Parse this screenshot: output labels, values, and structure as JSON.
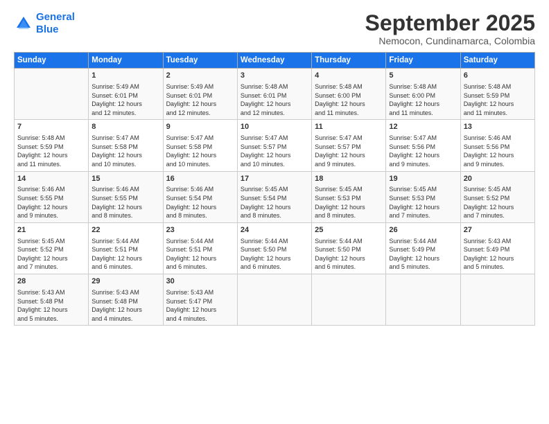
{
  "logo": {
    "line1": "General",
    "line2": "Blue"
  },
  "title": "September 2025",
  "subtitle": "Nemocon, Cundinamarca, Colombia",
  "days_of_week": [
    "Sunday",
    "Monday",
    "Tuesday",
    "Wednesday",
    "Thursday",
    "Friday",
    "Saturday"
  ],
  "weeks": [
    [
      {
        "day": "",
        "text": ""
      },
      {
        "day": "1",
        "text": "Sunrise: 5:49 AM\nSunset: 6:01 PM\nDaylight: 12 hours\nand 12 minutes."
      },
      {
        "day": "2",
        "text": "Sunrise: 5:49 AM\nSunset: 6:01 PM\nDaylight: 12 hours\nand 12 minutes."
      },
      {
        "day": "3",
        "text": "Sunrise: 5:48 AM\nSunset: 6:01 PM\nDaylight: 12 hours\nand 12 minutes."
      },
      {
        "day": "4",
        "text": "Sunrise: 5:48 AM\nSunset: 6:00 PM\nDaylight: 12 hours\nand 11 minutes."
      },
      {
        "day": "5",
        "text": "Sunrise: 5:48 AM\nSunset: 6:00 PM\nDaylight: 12 hours\nand 11 minutes."
      },
      {
        "day": "6",
        "text": "Sunrise: 5:48 AM\nSunset: 5:59 PM\nDaylight: 12 hours\nand 11 minutes."
      }
    ],
    [
      {
        "day": "7",
        "text": "Sunrise: 5:48 AM\nSunset: 5:59 PM\nDaylight: 12 hours\nand 11 minutes."
      },
      {
        "day": "8",
        "text": "Sunrise: 5:47 AM\nSunset: 5:58 PM\nDaylight: 12 hours\nand 10 minutes."
      },
      {
        "day": "9",
        "text": "Sunrise: 5:47 AM\nSunset: 5:58 PM\nDaylight: 12 hours\nand 10 minutes."
      },
      {
        "day": "10",
        "text": "Sunrise: 5:47 AM\nSunset: 5:57 PM\nDaylight: 12 hours\nand 10 minutes."
      },
      {
        "day": "11",
        "text": "Sunrise: 5:47 AM\nSunset: 5:57 PM\nDaylight: 12 hours\nand 9 minutes."
      },
      {
        "day": "12",
        "text": "Sunrise: 5:47 AM\nSunset: 5:56 PM\nDaylight: 12 hours\nand 9 minutes."
      },
      {
        "day": "13",
        "text": "Sunrise: 5:46 AM\nSunset: 5:56 PM\nDaylight: 12 hours\nand 9 minutes."
      }
    ],
    [
      {
        "day": "14",
        "text": "Sunrise: 5:46 AM\nSunset: 5:55 PM\nDaylight: 12 hours\nand 9 minutes."
      },
      {
        "day": "15",
        "text": "Sunrise: 5:46 AM\nSunset: 5:55 PM\nDaylight: 12 hours\nand 8 minutes."
      },
      {
        "day": "16",
        "text": "Sunrise: 5:46 AM\nSunset: 5:54 PM\nDaylight: 12 hours\nand 8 minutes."
      },
      {
        "day": "17",
        "text": "Sunrise: 5:45 AM\nSunset: 5:54 PM\nDaylight: 12 hours\nand 8 minutes."
      },
      {
        "day": "18",
        "text": "Sunrise: 5:45 AM\nSunset: 5:53 PM\nDaylight: 12 hours\nand 8 minutes."
      },
      {
        "day": "19",
        "text": "Sunrise: 5:45 AM\nSunset: 5:53 PM\nDaylight: 12 hours\nand 7 minutes."
      },
      {
        "day": "20",
        "text": "Sunrise: 5:45 AM\nSunset: 5:52 PM\nDaylight: 12 hours\nand 7 minutes."
      }
    ],
    [
      {
        "day": "21",
        "text": "Sunrise: 5:45 AM\nSunset: 5:52 PM\nDaylight: 12 hours\nand 7 minutes."
      },
      {
        "day": "22",
        "text": "Sunrise: 5:44 AM\nSunset: 5:51 PM\nDaylight: 12 hours\nand 6 minutes."
      },
      {
        "day": "23",
        "text": "Sunrise: 5:44 AM\nSunset: 5:51 PM\nDaylight: 12 hours\nand 6 minutes."
      },
      {
        "day": "24",
        "text": "Sunrise: 5:44 AM\nSunset: 5:50 PM\nDaylight: 12 hours\nand 6 minutes."
      },
      {
        "day": "25",
        "text": "Sunrise: 5:44 AM\nSunset: 5:50 PM\nDaylight: 12 hours\nand 6 minutes."
      },
      {
        "day": "26",
        "text": "Sunrise: 5:44 AM\nSunset: 5:49 PM\nDaylight: 12 hours\nand 5 minutes."
      },
      {
        "day": "27",
        "text": "Sunrise: 5:43 AM\nSunset: 5:49 PM\nDaylight: 12 hours\nand 5 minutes."
      }
    ],
    [
      {
        "day": "28",
        "text": "Sunrise: 5:43 AM\nSunset: 5:48 PM\nDaylight: 12 hours\nand 5 minutes."
      },
      {
        "day": "29",
        "text": "Sunrise: 5:43 AM\nSunset: 5:48 PM\nDaylight: 12 hours\nand 4 minutes."
      },
      {
        "day": "30",
        "text": "Sunrise: 5:43 AM\nSunset: 5:47 PM\nDaylight: 12 hours\nand 4 minutes."
      },
      {
        "day": "",
        "text": ""
      },
      {
        "day": "",
        "text": ""
      },
      {
        "day": "",
        "text": ""
      },
      {
        "day": "",
        "text": ""
      }
    ]
  ]
}
